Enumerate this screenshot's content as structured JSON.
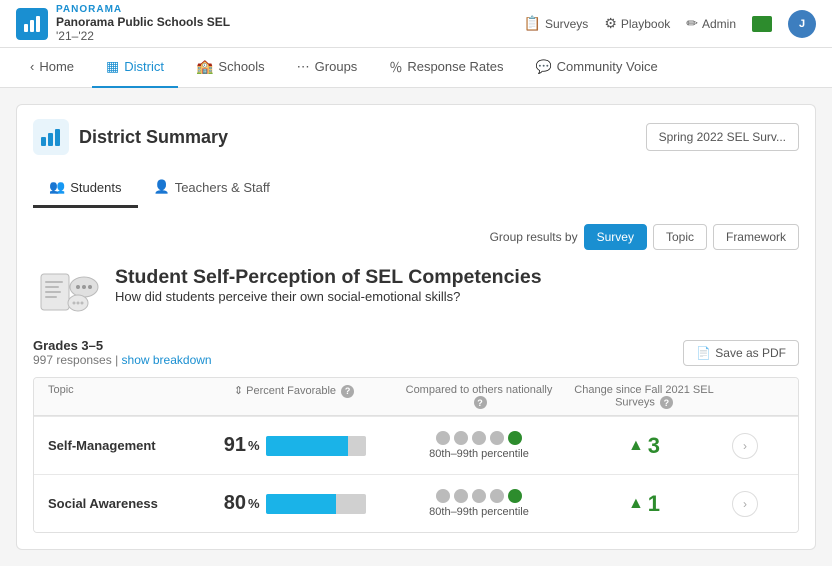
{
  "app": {
    "logo_text": "PANORAMA",
    "title_line1": "Panorama Public Schools SEL",
    "title_line2": "'21–'22"
  },
  "top_nav": {
    "surveys_label": "Surveys",
    "playbook_label": "Playbook",
    "admin_label": "Admin",
    "user_initial": "J"
  },
  "second_nav": {
    "home_label": "Home",
    "district_label": "District",
    "schools_label": "Schools",
    "groups_label": "Groups",
    "response_rates_label": "Response Rates",
    "community_voice_label": "Community Voice"
  },
  "page": {
    "title": "District Summary",
    "survey_btn_label": "Spring 2022 SEL Surv..."
  },
  "tabs": {
    "students_label": "Students",
    "teachers_label": "Teachers & Staff"
  },
  "group_results": {
    "label": "Group results by",
    "survey_label": "Survey",
    "topic_label": "Topic",
    "framework_label": "Framework"
  },
  "survey_block": {
    "title": "Student Self-Perception of SEL Competencies",
    "subtitle": "How did students perceive their own social-emotional skills?",
    "grades": "Grades 3–5",
    "responses": "997 responses",
    "show_breakdown": "show breakdown",
    "save_pdf": "Save as PDF"
  },
  "table": {
    "col_topic": "Topic",
    "col_percent": "⇕ Percent Favorable",
    "col_compare": "Compared to others nationally",
    "col_change": "Change since Fall 2021 SEL Surveys",
    "rows": [
      {
        "topic": "Self-Management",
        "percent": 91,
        "bar_filled_width": 82,
        "bar_empty_width": 18,
        "dots": [
          false,
          false,
          false,
          false,
          true
        ],
        "percentile": "80th–99th percentile",
        "change": 3,
        "change_direction": "up"
      },
      {
        "topic": "Social Awareness",
        "percent": 80,
        "bar_filled_width": 70,
        "bar_empty_width": 30,
        "dots": [
          false,
          false,
          false,
          false,
          true
        ],
        "percentile": "80th–99th percentile",
        "change": 1,
        "change_direction": "up"
      }
    ]
  }
}
